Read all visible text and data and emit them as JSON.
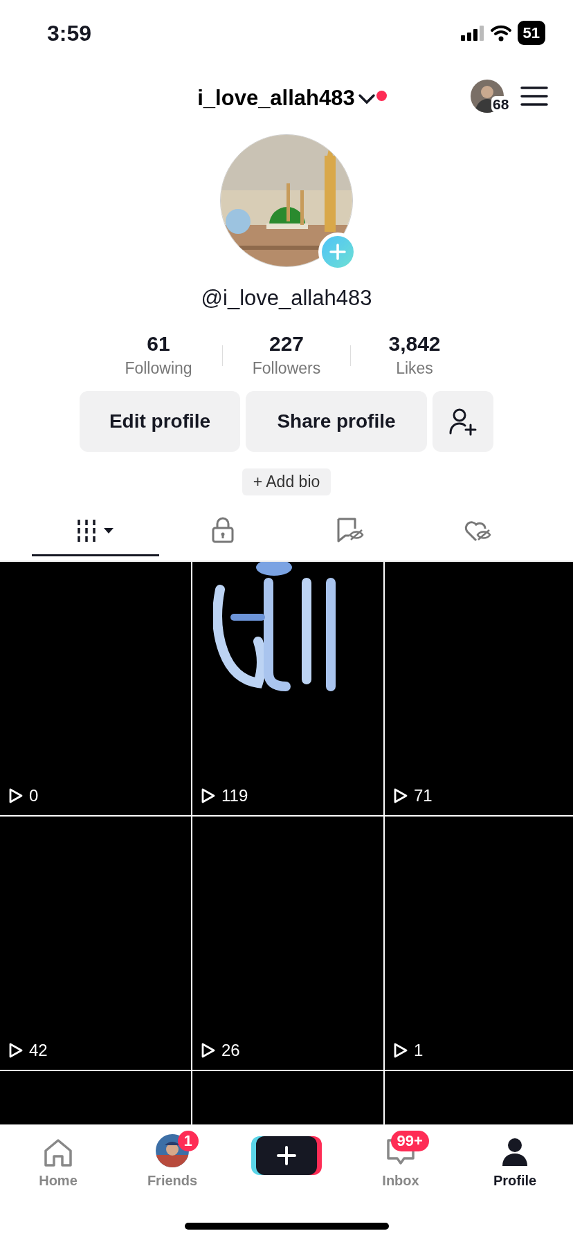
{
  "status_bar": {
    "time": "3:59",
    "battery": "51"
  },
  "header": {
    "username": "i_love_allah483",
    "notification_dot": true,
    "avatar_badge": "68"
  },
  "profile": {
    "handle": "@i_love_allah483",
    "add_avatar": true
  },
  "stats": [
    {
      "value": "61",
      "label": "Following"
    },
    {
      "value": "227",
      "label": "Followers"
    },
    {
      "value": "3,842",
      "label": "Likes"
    }
  ],
  "buttons": [
    {
      "kind": "text",
      "label": "Edit profile"
    },
    {
      "kind": "text",
      "label": "Share profile"
    },
    {
      "kind": "add-friend"
    }
  ],
  "add_bio": "+ Add bio",
  "tabs": [
    {
      "kind": "videos",
      "selected": true
    },
    {
      "kind": "private",
      "selected": false
    },
    {
      "kind": "saved",
      "selected": false
    },
    {
      "kind": "liked",
      "selected": false
    }
  ],
  "videos": [
    {
      "kind": "blank",
      "views": "0"
    },
    {
      "kind": "picture",
      "views": "119"
    },
    {
      "kind": "blank",
      "views": "71"
    },
    {
      "kind": "blank",
      "views": "42"
    },
    {
      "kind": "blank",
      "views": "26"
    },
    {
      "kind": "blank",
      "views": "1"
    },
    {
      "kind": "blank"
    },
    {
      "kind": "blank"
    },
    {
      "kind": "blank"
    }
  ],
  "nav": [
    {
      "kind": "home",
      "label": "Home",
      "selected": false
    },
    {
      "kind": "friends",
      "label": "Friends",
      "badge": "1",
      "selected": false
    },
    {
      "kind": "create"
    },
    {
      "kind": "inbox",
      "label": "Inbox",
      "badge": "99+",
      "selected": false
    },
    {
      "kind": "profile",
      "label": "Profile",
      "selected": true
    }
  ]
}
